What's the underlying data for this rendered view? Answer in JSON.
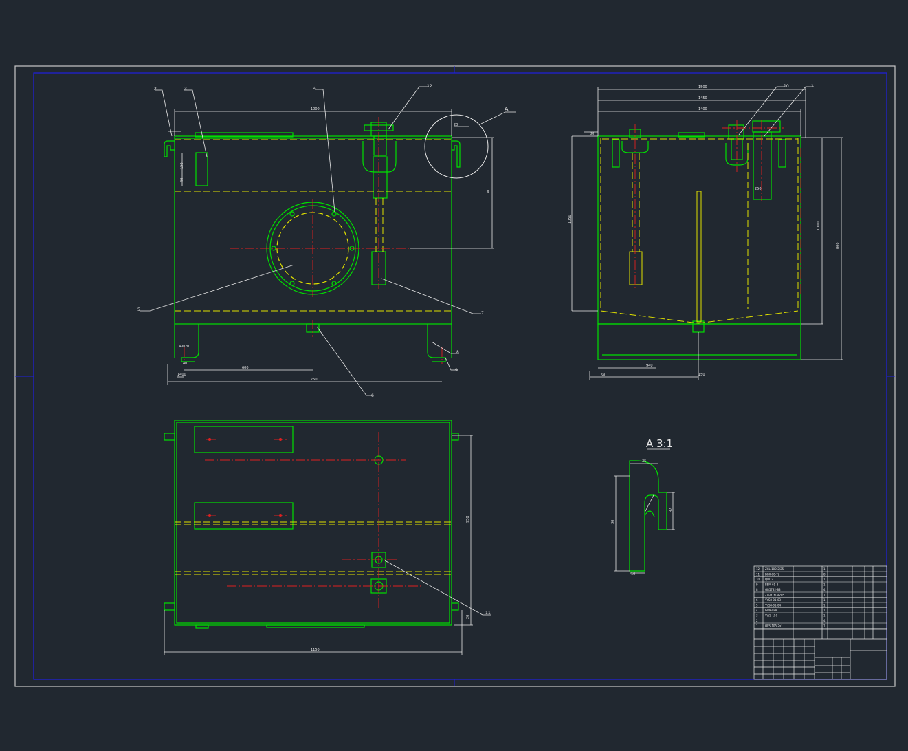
{
  "colors": {
    "background": "#212830",
    "outer_frame": "#c8c8c8",
    "inner_frame": "#2020e0",
    "part": "#00e000",
    "hidden": "#e0e000",
    "center": "#e02020",
    "dim": "#e8e8e8",
    "title_magenta": "#e000e0",
    "title_red": "#e02020"
  },
  "drawing": {
    "detail_label": "A   3:1",
    "callout_A": "A",
    "balloons": {
      "front": [
        "2",
        "3",
        "4",
        "12",
        "5",
        "7",
        "6",
        "8",
        "9"
      ],
      "side": [
        "10",
        "1"
      ],
      "plan": [
        "11"
      ]
    },
    "front_dims": [
      "1000",
      "20",
      "150",
      "40",
      "30",
      "600",
      "750",
      "1400",
      "40",
      "4-Φ20"
    ],
    "side_dims": [
      "1500",
      "1450",
      "1400",
      "50",
      "80",
      "1050",
      "1000",
      "800",
      "940",
      "150",
      "250"
    ],
    "plan_dims": [
      "1150",
      "950",
      "20"
    ],
    "detail_dims": [
      "35",
      "10",
      "30",
      "R7"
    ]
  },
  "title_block": {
    "bom_rows": [
      [
        "12",
        "ZCL-100-2/25",
        "",
        "1",
        "",
        ""
      ],
      [
        "11",
        "BOX-60-7b",
        "",
        "8",
        "",
        ""
      ],
      [
        "10",
        "QUQ2",
        "",
        "1",
        "",
        ""
      ],
      [
        "9",
        "BEM-65-3",
        "",
        "1",
        "",
        ""
      ],
      [
        "8",
        "GB5782-88",
        "",
        "4",
        "",
        ""
      ],
      [
        "7",
        "ZU-H160X20S",
        "",
        "1",
        "",
        ""
      ],
      [
        "6",
        "YYS8-01-03",
        "",
        "1",
        "",
        ""
      ],
      [
        "5",
        "YYS8-01-04",
        "",
        "1",
        "",
        ""
      ],
      [
        "4",
        "GB93-88",
        "",
        "1",
        "",
        ""
      ],
      [
        "3",
        "YWZ-150",
        "",
        "1",
        "",
        ""
      ],
      [
        "2",
        "",
        "",
        "4",
        "",
        ""
      ],
      [
        "1",
        "QFS-105-2x1",
        "",
        "1",
        "",
        ""
      ]
    ]
  }
}
